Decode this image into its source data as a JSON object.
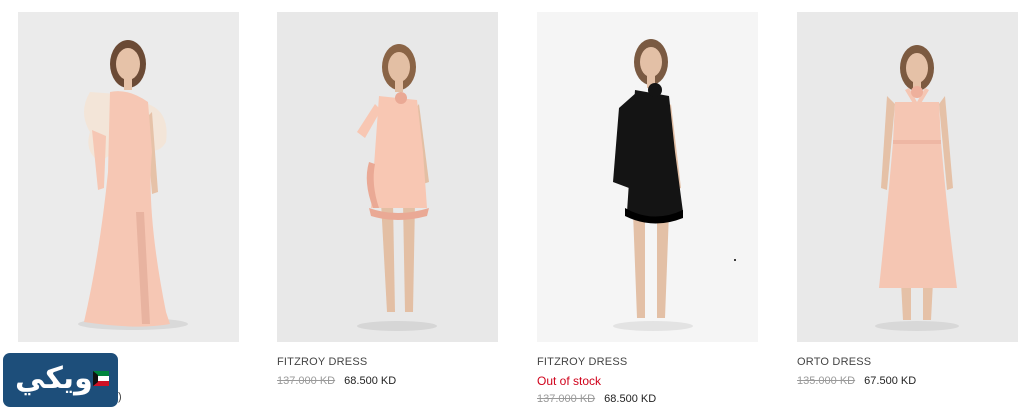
{
  "products": [
    {
      "name": "",
      "stock": "",
      "old_price": "",
      "price": "",
      "image": "pink-one-shoulder-gown-image",
      "colors": {
        "bg": "#ebebeb",
        "dress": "#f6c7b4",
        "sleeve": "#f3e5d8"
      }
    },
    {
      "name": "FITZROY DRESS",
      "stock": "",
      "old_price": "137.000 KD",
      "price": "68.500 KD",
      "image": "pink-ruffle-mini-dress-image",
      "colors": {
        "bg": "#e8e8e8",
        "dress": "#f8c7b3"
      }
    },
    {
      "name": "FITZROY DRESS",
      "stock": "Out of stock",
      "old_price": "137.000 KD",
      "price": "68.500 KD",
      "image": "black-ruffle-mini-dress-image",
      "colors": {
        "bg": "#f5f5f5",
        "dress": "#141414"
      }
    },
    {
      "name": "ORTO DRESS",
      "stock": "",
      "old_price": "135.000 KD",
      "price": "67.500 KD",
      "image": "pink-halter-midi-dress-image",
      "colors": {
        "bg": "#e9e9e9",
        "dress": "#f5c6b3"
      }
    }
  ],
  "partial_text": ")",
  "watermark": {
    "text": "ويكي",
    "icon": "kuwait-flag-icon",
    "bg": "#1d4e7a"
  },
  "colors": {
    "out_of_stock": "#d0021b",
    "old_price": "#9a9a9a"
  }
}
